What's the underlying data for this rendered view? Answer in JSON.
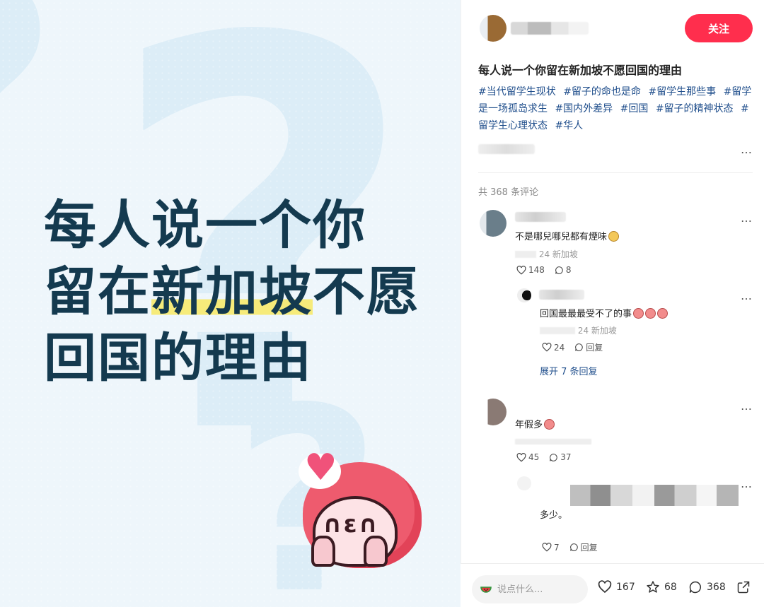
{
  "cover": {
    "title_lines": [
      "每人说一个你",
      "留在",
      "新加坡",
      "不愿",
      "回国的理由"
    ]
  },
  "post": {
    "follow_label": "关注",
    "title": "每人说一个你留在新加坡不愿回国的理由",
    "tags": [
      "#当代留学生现状",
      "#留子的命也是命",
      "#留学生那些事",
      "#留学是一场孤岛求生",
      "#国内外差异",
      "#回国",
      "#留子的精神状态",
      "#留学生心理状态",
      "#华人"
    ],
    "more_icon": "…",
    "comment_count": "共 368 条评论"
  },
  "comments": [
    {
      "text": "不是哪兒哪兒都有煙味",
      "meta": "24 新加坡",
      "likes": "148",
      "replies_count": "8"
    },
    {
      "text": "回国最最最受不了的事",
      "meta": "24 新加坡",
      "likes": "24",
      "reply_label": "回复",
      "expand": "展开 7 条回复"
    },
    {
      "text": "年假多",
      "likes": "45",
      "replies_count": "37"
    },
    {
      "text": "多少。",
      "likes": "7",
      "reply_label": "回复"
    }
  ],
  "bottom": {
    "input_placeholder": "说点什么...",
    "likes": "167",
    "stars": "68",
    "comments": "368"
  },
  "colors": {
    "follow": "#ff2e4d",
    "tag": "#1e4d8b",
    "cover_title": "#143a4f",
    "highlight": "#f6eb7a"
  }
}
